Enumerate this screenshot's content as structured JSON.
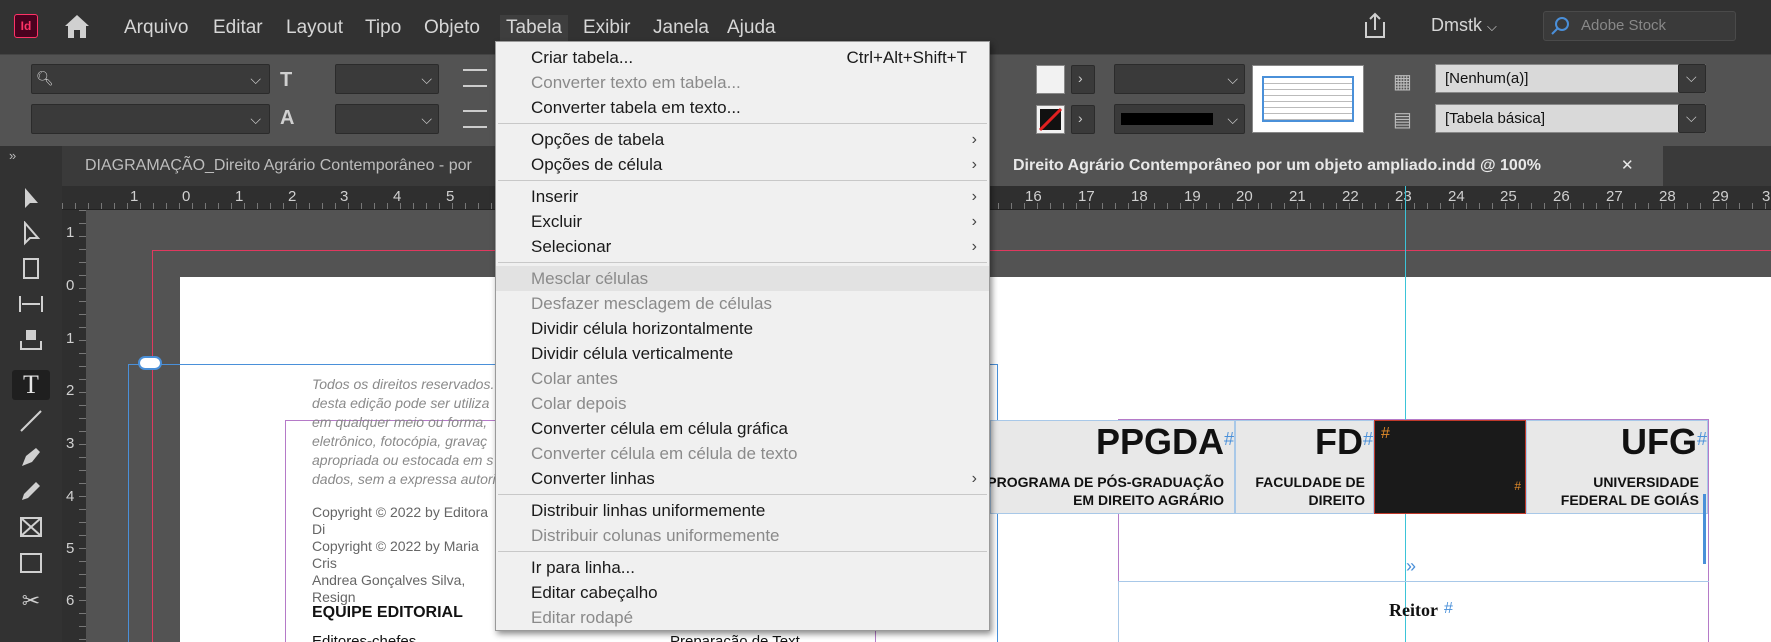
{
  "app": {
    "logo_text": "Id"
  },
  "menubar": {
    "items": [
      "Arquivo",
      "Editar",
      "Layout",
      "Tipo",
      "Objeto",
      "Tabela",
      "Exibir",
      "Janela",
      "Ajuda"
    ],
    "active": "Tabela",
    "user": "Dmstk",
    "search_placeholder": "Adobe Stock"
  },
  "control_panel": {
    "cell_style": "[Nenhum(a)]",
    "table_style": "[Tabela básica]"
  },
  "tabs": {
    "doc1": "DIAGRAMAÇÃO_Direito Agrário Contemporâneo - por",
    "doc2": "Direito Agrário Contemporâneo por um objeto ampliado.indd @ 100%",
    "close_glyph": "✕"
  },
  "ruler_h": [
    "1",
    "0",
    "1",
    "2",
    "3",
    "4",
    "5",
    "16",
    "17",
    "18",
    "19",
    "20",
    "21",
    "22",
    "23",
    "24",
    "25",
    "26",
    "27",
    "28",
    "29",
    "3"
  ],
  "ruler_v": [
    "1",
    "0",
    "1",
    "2",
    "3",
    "4",
    "5",
    "6"
  ],
  "document": {
    "rights_lines": [
      "Todos os direitos reservados.",
      "desta edição pode ser utiliza",
      "em qualquer meio ou forma,",
      "eletrônico, fotocópia, gravaç",
      "apropriada ou estocada em s",
      "dados, sem a expressa autori"
    ],
    "copyright_lines": [
      "Copyright © 2022 by Editora Di",
      "Copyright © 2022 by Maria Cris",
      "Andrea Gonçalves Silva, Resign"
    ],
    "equipe": "EQUIPE EDITORIAL",
    "editores": "Editores-chefes",
    "revisao": "Preparação de Text",
    "table": {
      "ppgda": "PPGDA",
      "fd": "FD",
      "ufg": "UFG",
      "ppgda_sub": "PROGRAMA DE PÓS-GRADUAÇÃO EM DIREITO AGRÁRIO",
      "fd_sub": "FACULDADE DE DIREITO",
      "ufg_sub": "UNIVERSIDADE FEDERAL DE GOIÁS",
      "reitor": "Reitor",
      "hash": "#"
    }
  },
  "dropdown": {
    "items": [
      {
        "label": "Criar tabela...",
        "shortcut": "Ctrl+Alt+Shift+T",
        "enabled": true
      },
      {
        "label": "Converter texto em tabela...",
        "enabled": false
      },
      {
        "label": "Converter tabela em texto...",
        "enabled": true
      },
      {
        "label": "Opções de tabela",
        "submenu": true,
        "enabled": true
      },
      {
        "label": "Opções de célula",
        "submenu": true,
        "enabled": true
      },
      {
        "label": "Inserir",
        "submenu": true,
        "enabled": true
      },
      {
        "label": "Excluir",
        "submenu": true,
        "enabled": true
      },
      {
        "label": "Selecionar",
        "submenu": true,
        "enabled": true
      },
      {
        "label": "Mesclar células",
        "enabled": false,
        "highlighted": true
      },
      {
        "label": "Desfazer mesclagem de células",
        "enabled": false
      },
      {
        "label": "Dividir célula horizontalmente",
        "enabled": true
      },
      {
        "label": "Dividir célula verticalmente",
        "enabled": true
      },
      {
        "label": "Colar antes",
        "enabled": false
      },
      {
        "label": "Colar depois",
        "enabled": false
      },
      {
        "label": "Converter célula em célula gráfica",
        "enabled": true
      },
      {
        "label": "Converter célula em célula de texto",
        "enabled": false
      },
      {
        "label": "Converter linhas",
        "submenu": true,
        "enabled": true
      },
      {
        "label": "Distribuir linhas uniformemente",
        "enabled": true
      },
      {
        "label": "Distribuir colunas uniformemente",
        "enabled": false
      },
      {
        "label": "Ir para linha...",
        "enabled": true
      },
      {
        "label": "Editar cabeçalho",
        "enabled": true
      },
      {
        "label": "Editar rodapé",
        "enabled": false
      }
    ],
    "submenu_arrow": "›"
  },
  "colors": {
    "accent": "#ff3366",
    "menu_bg": "#323232",
    "panel_bg": "#535353",
    "dropdown_bg": "#f0f0f0"
  },
  "icons": [
    "home-icon",
    "share-icon",
    "search-icon",
    "selection-tool-icon",
    "direct-selection-tool-icon",
    "page-tool-icon",
    "gap-tool-icon",
    "content-collector-icon",
    "type-tool-icon",
    "line-tool-icon",
    "pen-tool-icon",
    "pencil-tool-icon",
    "rectangle-frame-tool-icon",
    "rectangle-tool-icon",
    "scissors-tool-icon"
  ]
}
